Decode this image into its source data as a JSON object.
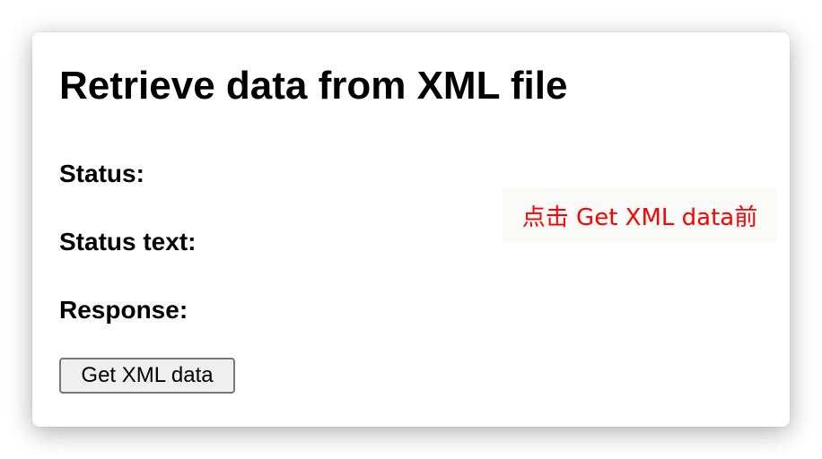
{
  "page": {
    "title": "Retrieve data from XML file",
    "status_label": "Status:",
    "status_text_label": "Status text:",
    "response_label": "Response:",
    "get_button_label": "Get XML data"
  },
  "annotation": {
    "text": "点击 Get XML data前",
    "color": "#ff0000"
  }
}
